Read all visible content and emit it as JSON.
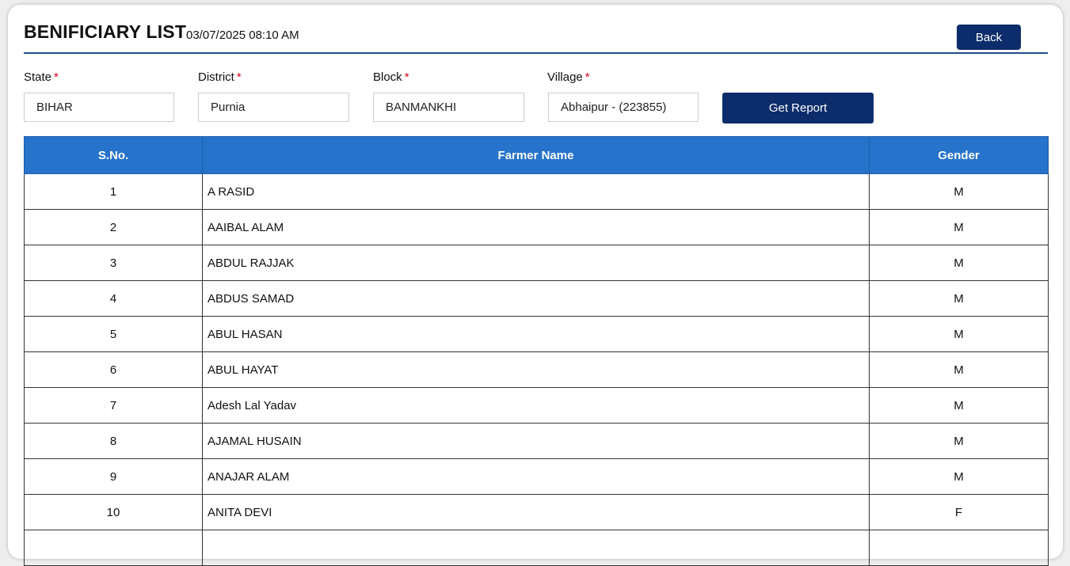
{
  "header": {
    "title": "BENIFICIARY LIST",
    "timestamp": "03/07/2025 08:10 AM",
    "back_label": "Back"
  },
  "filters": {
    "state": {
      "label": "State",
      "required": "*",
      "value": "BIHAR"
    },
    "district": {
      "label": "District",
      "required": "*",
      "value": "Purnia"
    },
    "block": {
      "label": "Block",
      "required": "*",
      "value": "BANMANKHI"
    },
    "village": {
      "label": "Village",
      "required": "*",
      "value": "Abhaipur - (223855)"
    },
    "report_label": "Get Report"
  },
  "table": {
    "headers": [
      "S.No.",
      "Farmer Name",
      "Gender"
    ],
    "rows": [
      {
        "sno": "1",
        "name": "A RASID",
        "gender": "M"
      },
      {
        "sno": "2",
        "name": "AAIBAL ALAM",
        "gender": "M"
      },
      {
        "sno": "3",
        "name": "ABDUL RAJJAK",
        "gender": "M"
      },
      {
        "sno": "4",
        "name": "ABDUS SAMAD",
        "gender": "M"
      },
      {
        "sno": "5",
        "name": "ABUL HASAN",
        "gender": "M"
      },
      {
        "sno": "6",
        "name": "ABUL HAYAT",
        "gender": "M"
      },
      {
        "sno": "7",
        "name": "Adesh Lal Yadav",
        "gender": "M"
      },
      {
        "sno": "8",
        "name": "AJAMAL HUSAIN",
        "gender": "M"
      },
      {
        "sno": "9",
        "name": "ANAJAR ALAM",
        "gender": "M"
      },
      {
        "sno": "10",
        "name": "ANITA DEVI",
        "gender": "F"
      }
    ]
  },
  "colors": {
    "primary_button": "#0d2c6b",
    "table_header": "#2673cc",
    "required_marker": "#d0021b"
  }
}
